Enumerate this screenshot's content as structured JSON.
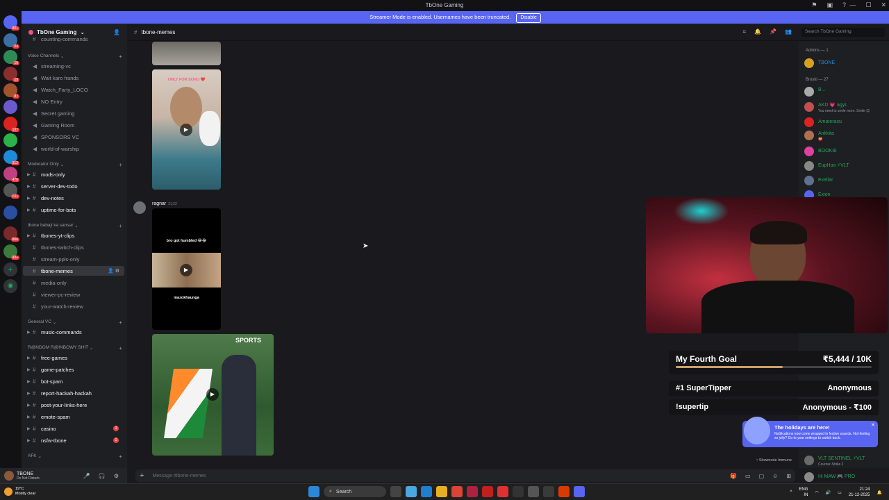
{
  "window": {
    "title": "TbOne Gaming",
    "banner_text": "Streamer Mode is enabled. Usernames have been truncated.",
    "banner_button": "Disable"
  },
  "server_rail": {
    "badges": [
      "801",
      "54",
      "10",
      "19",
      "87",
      "197",
      "912",
      "476",
      "611",
      "806",
      "99+"
    ]
  },
  "sidebar": {
    "guild_name": "TbOne Gaming",
    "truncated_top_item": "counting-commands",
    "categories": {
      "voice": "Voice Channels",
      "moderator": "Moderator Only",
      "tbone_babaji": "tbone babaji ka sansar",
      "general_vc": "General VC",
      "random": "R@NDOM R@INBOWY SHIT",
      "afk": "AFK"
    },
    "voice_channels": [
      "streaming-vc",
      "Wait karo frands",
      "Watch_Farty_LOCO",
      "NO Entry",
      "Secret gaming",
      "Gaming Room",
      "SPONSORS VC",
      "world-of-warship"
    ],
    "moderator_channels": [
      "mods-only",
      "server-dev-todo",
      "dev-notes",
      "uptime-for-bots"
    ],
    "tbone_channels": [
      "tbones-yt-clips",
      "tbones-twitch-clips",
      "stream-ppls-only",
      "tbone-memes",
      "media-only",
      "viewer-pc-review",
      "your-watch-review"
    ],
    "general_vc_channels": [
      "music-commands"
    ],
    "random_channels": [
      "free-games",
      "game-patches",
      "bot-spam",
      "report-hackah-hackah",
      "post-your-links-here",
      "emote-spam",
      "casino",
      "nsfw-tbone"
    ],
    "pings": {
      "casino": "1",
      "nsfw_tbone": "1"
    }
  },
  "user_panel": {
    "username": "TBONE",
    "status": "Do Not Disturb"
  },
  "channel": {
    "name": "tbone-memes",
    "search_placeholder": "Search TbOne Gaming",
    "composer_placeholder": "Message #tbone-memes"
  },
  "messages": {
    "author": "ragnar",
    "time": "21:22",
    "meme_caption_top": "bro got humbled 😂😂",
    "meme_caption_bottom": "mazokhaunga",
    "video_overlay_top": "ONLY FOR SONU ❤️",
    "sports_logo": "SPORTS"
  },
  "members": {
    "admins_header": "Admins — 1",
    "admin_name": "TBONE",
    "broski_header": "Broski — 27",
    "list": [
      {
        "name": "B...",
        "sub": ""
      },
      {
        "name": "AKD 💗 agyL",
        "sub": "You need to smile more. Smile 😊"
      },
      {
        "name": "Amaterasu",
        "sub": ""
      },
      {
        "name": "Ankkita",
        "sub": "🍑"
      },
      {
        "name": "BOOKIE",
        "sub": ""
      },
      {
        "name": "EupHoo ⚡VLT",
        "sub": ""
      },
      {
        "name": "Exellar",
        "sub": ""
      },
      {
        "name": "Exion",
        "sub": ""
      }
    ],
    "bottom_list": [
      {
        "name": "VLT SENTINEL ⚡VLT",
        "sub": "Counter-Strike 2"
      },
      {
        "name": "Hi MAW 🎮 PRO",
        "sub": ""
      }
    ]
  },
  "overlay": {
    "goal_title": "My Fourth Goal",
    "goal_value": "₹5,444 / 10K",
    "goal_progress": 0.5444,
    "supertipper_label": "#1 SuperTipper",
    "supertipper_value": "Anonymous",
    "supertip_label": "!supertip",
    "supertip_value": "Anonymous - ₹100"
  },
  "notification": {
    "title": "The holidays are here!",
    "body": "Notifications now come wrapped in festive sounds. Not feeling so jolly? Go to your settings to switch back."
  },
  "slowmode_text": "Slowmode Immune",
  "taskbar": {
    "temp": "19°C",
    "weather": "Mostly clear",
    "search": "Search",
    "lang": "ENG",
    "region": "IN",
    "time": "21:24",
    "date": "21-12-2025"
  },
  "colors": {
    "accent": "#5865f2",
    "online": "#23a55a",
    "mention": "#f23f43"
  }
}
